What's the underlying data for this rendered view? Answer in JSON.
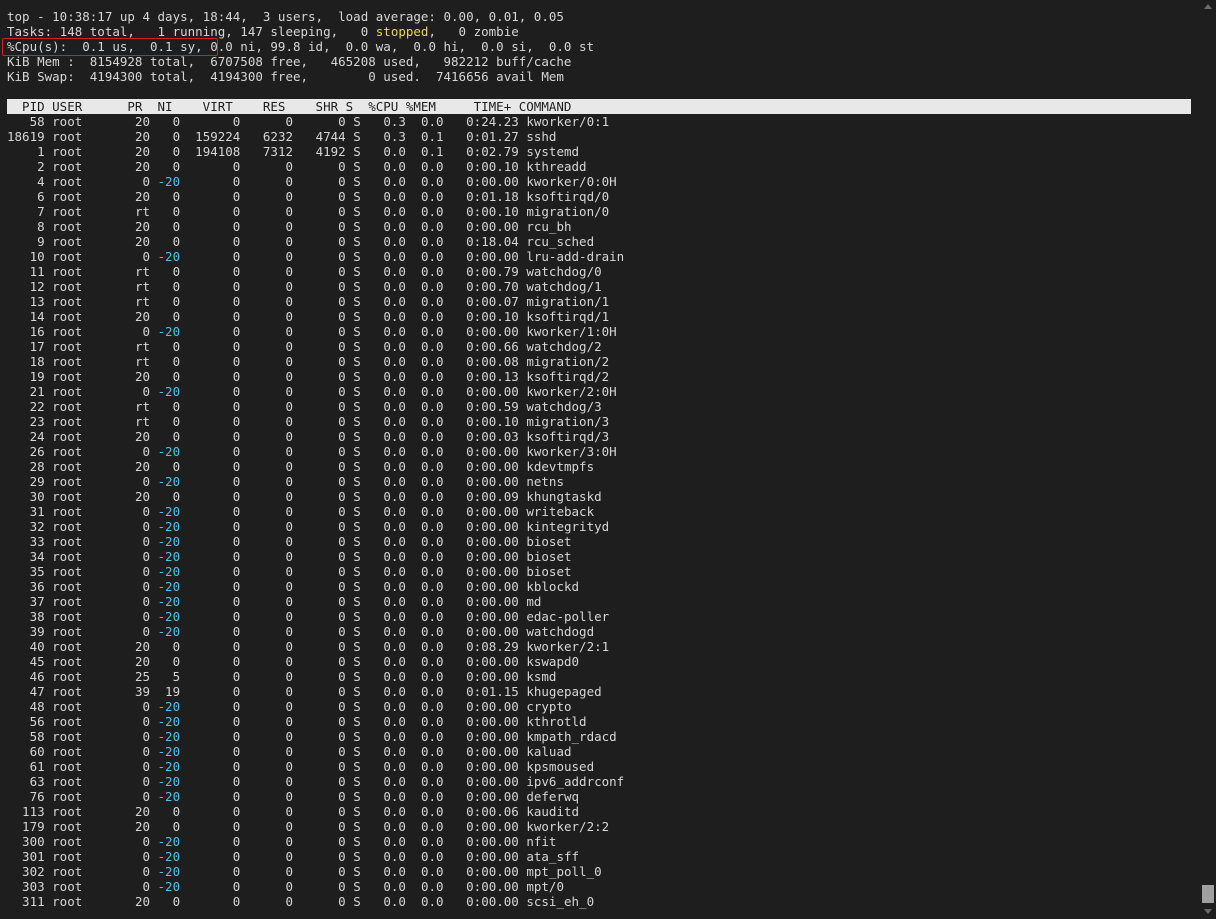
{
  "summary": {
    "top": "top - 10:38:17 up 4 days, 18:44,  3 users,  load average: 0.00, 0.01, 0.05",
    "tasks_before": "Tasks: 148 total,   1 running, 147 sleeping,   0 ",
    "tasks_stopped": "stopped",
    "tasks_after": ",   0 zombie",
    "cpu_highlighted": "%Cpu(s):  0.1 us,  0.1 sy,",
    "cpu_rest": " 0.0 ni, 99.8 id,  0.0 wa,  0.0 hi,  0.0 si,  0.0 st",
    "mem": "KiB Mem :  8154928 total,  6707508 free,   465208 used,   982212 buff/cache",
    "swap": "KiB Swap:  4194300 total,  4194300 free,        0 used.  7416656 avail Mem"
  },
  "header": "  PID USER      PR  NI    VIRT    RES    SHR S  %CPU %MEM     TIME+ COMMAND",
  "colors": {
    "background": "#1e1e1e",
    "text": "#d6d6d6",
    "stopped": "#e6d84a",
    "negative_nice": "#4fc1e9",
    "header_bg": "#e8e8e8",
    "highlight": "#d0202a"
  },
  "processes": [
    {
      "pid": "58",
      "user": "root",
      "pr": "20",
      "ni": "0",
      "virt": "0",
      "res": "0",
      "shr": "0",
      "s": "S",
      "cpu": "0.3",
      "mem": "0.0",
      "time": "0:24.23",
      "cmd": "kworker/0:1"
    },
    {
      "pid": "18619",
      "user": "root",
      "pr": "20",
      "ni": "0",
      "virt": "159224",
      "res": "6232",
      "shr": "4744",
      "s": "S",
      "cpu": "0.3",
      "mem": "0.1",
      "time": "0:01.27",
      "cmd": "sshd"
    },
    {
      "pid": "1",
      "user": "root",
      "pr": "20",
      "ni": "0",
      "virt": "194108",
      "res": "7312",
      "shr": "4192",
      "s": "S",
      "cpu": "0.0",
      "mem": "0.1",
      "time": "0:02.79",
      "cmd": "systemd"
    },
    {
      "pid": "2",
      "user": "root",
      "pr": "20",
      "ni": "0",
      "virt": "0",
      "res": "0",
      "shr": "0",
      "s": "S",
      "cpu": "0.0",
      "mem": "0.0",
      "time": "0:00.10",
      "cmd": "kthreadd"
    },
    {
      "pid": "4",
      "user": "root",
      "pr": "0",
      "ni": "-20",
      "virt": "0",
      "res": "0",
      "shr": "0",
      "s": "S",
      "cpu": "0.0",
      "mem": "0.0",
      "time": "0:00.00",
      "cmd": "kworker/0:0H"
    },
    {
      "pid": "6",
      "user": "root",
      "pr": "20",
      "ni": "0",
      "virt": "0",
      "res": "0",
      "shr": "0",
      "s": "S",
      "cpu": "0.0",
      "mem": "0.0",
      "time": "0:01.18",
      "cmd": "ksoftirqd/0"
    },
    {
      "pid": "7",
      "user": "root",
      "pr": "rt",
      "ni": "0",
      "virt": "0",
      "res": "0",
      "shr": "0",
      "s": "S",
      "cpu": "0.0",
      "mem": "0.0",
      "time": "0:00.10",
      "cmd": "migration/0"
    },
    {
      "pid": "8",
      "user": "root",
      "pr": "20",
      "ni": "0",
      "virt": "0",
      "res": "0",
      "shr": "0",
      "s": "S",
      "cpu": "0.0",
      "mem": "0.0",
      "time": "0:00.00",
      "cmd": "rcu_bh"
    },
    {
      "pid": "9",
      "user": "root",
      "pr": "20",
      "ni": "0",
      "virt": "0",
      "res": "0",
      "shr": "0",
      "s": "S",
      "cpu": "0.0",
      "mem": "0.0",
      "time": "0:18.04",
      "cmd": "rcu_sched"
    },
    {
      "pid": "10",
      "user": "root",
      "pr": "0",
      "ni": "-20",
      "virt": "0",
      "res": "0",
      "shr": "0",
      "s": "S",
      "cpu": "0.0",
      "mem": "0.0",
      "time": "0:00.00",
      "cmd": "lru-add-drain"
    },
    {
      "pid": "11",
      "user": "root",
      "pr": "rt",
      "ni": "0",
      "virt": "0",
      "res": "0",
      "shr": "0",
      "s": "S",
      "cpu": "0.0",
      "mem": "0.0",
      "time": "0:00.79",
      "cmd": "watchdog/0"
    },
    {
      "pid": "12",
      "user": "root",
      "pr": "rt",
      "ni": "0",
      "virt": "0",
      "res": "0",
      "shr": "0",
      "s": "S",
      "cpu": "0.0",
      "mem": "0.0",
      "time": "0:00.70",
      "cmd": "watchdog/1"
    },
    {
      "pid": "13",
      "user": "root",
      "pr": "rt",
      "ni": "0",
      "virt": "0",
      "res": "0",
      "shr": "0",
      "s": "S",
      "cpu": "0.0",
      "mem": "0.0",
      "time": "0:00.07",
      "cmd": "migration/1"
    },
    {
      "pid": "14",
      "user": "root",
      "pr": "20",
      "ni": "0",
      "virt": "0",
      "res": "0",
      "shr": "0",
      "s": "S",
      "cpu": "0.0",
      "mem": "0.0",
      "time": "0:00.10",
      "cmd": "ksoftirqd/1"
    },
    {
      "pid": "16",
      "user": "root",
      "pr": "0",
      "ni": "-20",
      "virt": "0",
      "res": "0",
      "shr": "0",
      "s": "S",
      "cpu": "0.0",
      "mem": "0.0",
      "time": "0:00.00",
      "cmd": "kworker/1:0H"
    },
    {
      "pid": "17",
      "user": "root",
      "pr": "rt",
      "ni": "0",
      "virt": "0",
      "res": "0",
      "shr": "0",
      "s": "S",
      "cpu": "0.0",
      "mem": "0.0",
      "time": "0:00.66",
      "cmd": "watchdog/2"
    },
    {
      "pid": "18",
      "user": "root",
      "pr": "rt",
      "ni": "0",
      "virt": "0",
      "res": "0",
      "shr": "0",
      "s": "S",
      "cpu": "0.0",
      "mem": "0.0",
      "time": "0:00.08",
      "cmd": "migration/2"
    },
    {
      "pid": "19",
      "user": "root",
      "pr": "20",
      "ni": "0",
      "virt": "0",
      "res": "0",
      "shr": "0",
      "s": "S",
      "cpu": "0.0",
      "mem": "0.0",
      "time": "0:00.13",
      "cmd": "ksoftirqd/2"
    },
    {
      "pid": "21",
      "user": "root",
      "pr": "0",
      "ni": "-20",
      "virt": "0",
      "res": "0",
      "shr": "0",
      "s": "S",
      "cpu": "0.0",
      "mem": "0.0",
      "time": "0:00.00",
      "cmd": "kworker/2:0H"
    },
    {
      "pid": "22",
      "user": "root",
      "pr": "rt",
      "ni": "0",
      "virt": "0",
      "res": "0",
      "shr": "0",
      "s": "S",
      "cpu": "0.0",
      "mem": "0.0",
      "time": "0:00.59",
      "cmd": "watchdog/3"
    },
    {
      "pid": "23",
      "user": "root",
      "pr": "rt",
      "ni": "0",
      "virt": "0",
      "res": "0",
      "shr": "0",
      "s": "S",
      "cpu": "0.0",
      "mem": "0.0",
      "time": "0:00.10",
      "cmd": "migration/3"
    },
    {
      "pid": "24",
      "user": "root",
      "pr": "20",
      "ni": "0",
      "virt": "0",
      "res": "0",
      "shr": "0",
      "s": "S",
      "cpu": "0.0",
      "mem": "0.0",
      "time": "0:00.03",
      "cmd": "ksoftirqd/3"
    },
    {
      "pid": "26",
      "user": "root",
      "pr": "0",
      "ni": "-20",
      "virt": "0",
      "res": "0",
      "shr": "0",
      "s": "S",
      "cpu": "0.0",
      "mem": "0.0",
      "time": "0:00.00",
      "cmd": "kworker/3:0H"
    },
    {
      "pid": "28",
      "user": "root",
      "pr": "20",
      "ni": "0",
      "virt": "0",
      "res": "0",
      "shr": "0",
      "s": "S",
      "cpu": "0.0",
      "mem": "0.0",
      "time": "0:00.00",
      "cmd": "kdevtmpfs"
    },
    {
      "pid": "29",
      "user": "root",
      "pr": "0",
      "ni": "-20",
      "virt": "0",
      "res": "0",
      "shr": "0",
      "s": "S",
      "cpu": "0.0",
      "mem": "0.0",
      "time": "0:00.00",
      "cmd": "netns"
    },
    {
      "pid": "30",
      "user": "root",
      "pr": "20",
      "ni": "0",
      "virt": "0",
      "res": "0",
      "shr": "0",
      "s": "S",
      "cpu": "0.0",
      "mem": "0.0",
      "time": "0:00.09",
      "cmd": "khungtaskd"
    },
    {
      "pid": "31",
      "user": "root",
      "pr": "0",
      "ni": "-20",
      "virt": "0",
      "res": "0",
      "shr": "0",
      "s": "S",
      "cpu": "0.0",
      "mem": "0.0",
      "time": "0:00.00",
      "cmd": "writeback"
    },
    {
      "pid": "32",
      "user": "root",
      "pr": "0",
      "ni": "-20",
      "virt": "0",
      "res": "0",
      "shr": "0",
      "s": "S",
      "cpu": "0.0",
      "mem": "0.0",
      "time": "0:00.00",
      "cmd": "kintegrityd"
    },
    {
      "pid": "33",
      "user": "root",
      "pr": "0",
      "ni": "-20",
      "virt": "0",
      "res": "0",
      "shr": "0",
      "s": "S",
      "cpu": "0.0",
      "mem": "0.0",
      "time": "0:00.00",
      "cmd": "bioset"
    },
    {
      "pid": "34",
      "user": "root",
      "pr": "0",
      "ni": "-20",
      "virt": "0",
      "res": "0",
      "shr": "0",
      "s": "S",
      "cpu": "0.0",
      "mem": "0.0",
      "time": "0:00.00",
      "cmd": "bioset"
    },
    {
      "pid": "35",
      "user": "root",
      "pr": "0",
      "ni": "-20",
      "virt": "0",
      "res": "0",
      "shr": "0",
      "s": "S",
      "cpu": "0.0",
      "mem": "0.0",
      "time": "0:00.00",
      "cmd": "bioset"
    },
    {
      "pid": "36",
      "user": "root",
      "pr": "0",
      "ni": "-20",
      "virt": "0",
      "res": "0",
      "shr": "0",
      "s": "S",
      "cpu": "0.0",
      "mem": "0.0",
      "time": "0:00.00",
      "cmd": "kblockd"
    },
    {
      "pid": "37",
      "user": "root",
      "pr": "0",
      "ni": "-20",
      "virt": "0",
      "res": "0",
      "shr": "0",
      "s": "S",
      "cpu": "0.0",
      "mem": "0.0",
      "time": "0:00.00",
      "cmd": "md"
    },
    {
      "pid": "38",
      "user": "root",
      "pr": "0",
      "ni": "-20",
      "virt": "0",
      "res": "0",
      "shr": "0",
      "s": "S",
      "cpu": "0.0",
      "mem": "0.0",
      "time": "0:00.00",
      "cmd": "edac-poller"
    },
    {
      "pid": "39",
      "user": "root",
      "pr": "0",
      "ni": "-20",
      "virt": "0",
      "res": "0",
      "shr": "0",
      "s": "S",
      "cpu": "0.0",
      "mem": "0.0",
      "time": "0:00.00",
      "cmd": "watchdogd"
    },
    {
      "pid": "40",
      "user": "root",
      "pr": "20",
      "ni": "0",
      "virt": "0",
      "res": "0",
      "shr": "0",
      "s": "S",
      "cpu": "0.0",
      "mem": "0.0",
      "time": "0:08.29",
      "cmd": "kworker/2:1"
    },
    {
      "pid": "45",
      "user": "root",
      "pr": "20",
      "ni": "0",
      "virt": "0",
      "res": "0",
      "shr": "0",
      "s": "S",
      "cpu": "0.0",
      "mem": "0.0",
      "time": "0:00.00",
      "cmd": "kswapd0"
    },
    {
      "pid": "46",
      "user": "root",
      "pr": "25",
      "ni": "5",
      "virt": "0",
      "res": "0",
      "shr": "0",
      "s": "S",
      "cpu": "0.0",
      "mem": "0.0",
      "time": "0:00.00",
      "cmd": "ksmd"
    },
    {
      "pid": "47",
      "user": "root",
      "pr": "39",
      "ni": "19",
      "virt": "0",
      "res": "0",
      "shr": "0",
      "s": "S",
      "cpu": "0.0",
      "mem": "0.0",
      "time": "0:01.15",
      "cmd": "khugepaged"
    },
    {
      "pid": "48",
      "user": "root",
      "pr": "0",
      "ni": "-20",
      "virt": "0",
      "res": "0",
      "shr": "0",
      "s": "S",
      "cpu": "0.0",
      "mem": "0.0",
      "time": "0:00.00",
      "cmd": "crypto"
    },
    {
      "pid": "56",
      "user": "root",
      "pr": "0",
      "ni": "-20",
      "virt": "0",
      "res": "0",
      "shr": "0",
      "s": "S",
      "cpu": "0.0",
      "mem": "0.0",
      "time": "0:00.00",
      "cmd": "kthrotld"
    },
    {
      "pid": "58",
      "user": "root",
      "pr": "0",
      "ni": "-20",
      "virt": "0",
      "res": "0",
      "shr": "0",
      "s": "S",
      "cpu": "0.0",
      "mem": "0.0",
      "time": "0:00.00",
      "cmd": "kmpath_rdacd"
    },
    {
      "pid": "60",
      "user": "root",
      "pr": "0",
      "ni": "-20",
      "virt": "0",
      "res": "0",
      "shr": "0",
      "s": "S",
      "cpu": "0.0",
      "mem": "0.0",
      "time": "0:00.00",
      "cmd": "kaluad"
    },
    {
      "pid": "61",
      "user": "root",
      "pr": "0",
      "ni": "-20",
      "virt": "0",
      "res": "0",
      "shr": "0",
      "s": "S",
      "cpu": "0.0",
      "mem": "0.0",
      "time": "0:00.00",
      "cmd": "kpsmoused"
    },
    {
      "pid": "63",
      "user": "root",
      "pr": "0",
      "ni": "-20",
      "virt": "0",
      "res": "0",
      "shr": "0",
      "s": "S",
      "cpu": "0.0",
      "mem": "0.0",
      "time": "0:00.00",
      "cmd": "ipv6_addrconf"
    },
    {
      "pid": "76",
      "user": "root",
      "pr": "0",
      "ni": "-20",
      "virt": "0",
      "res": "0",
      "shr": "0",
      "s": "S",
      "cpu": "0.0",
      "mem": "0.0",
      "time": "0:00.00",
      "cmd": "deferwq"
    },
    {
      "pid": "113",
      "user": "root",
      "pr": "20",
      "ni": "0",
      "virt": "0",
      "res": "0",
      "shr": "0",
      "s": "S",
      "cpu": "0.0",
      "mem": "0.0",
      "time": "0:00.06",
      "cmd": "kauditd"
    },
    {
      "pid": "179",
      "user": "root",
      "pr": "20",
      "ni": "0",
      "virt": "0",
      "res": "0",
      "shr": "0",
      "s": "S",
      "cpu": "0.0",
      "mem": "0.0",
      "time": "0:00.00",
      "cmd": "kworker/2:2"
    },
    {
      "pid": "300",
      "user": "root",
      "pr": "0",
      "ni": "-20",
      "virt": "0",
      "res": "0",
      "shr": "0",
      "s": "S",
      "cpu": "0.0",
      "mem": "0.0",
      "time": "0:00.00",
      "cmd": "nfit"
    },
    {
      "pid": "301",
      "user": "root",
      "pr": "0",
      "ni": "-20",
      "virt": "0",
      "res": "0",
      "shr": "0",
      "s": "S",
      "cpu": "0.0",
      "mem": "0.0",
      "time": "0:00.00",
      "cmd": "ata_sff"
    },
    {
      "pid": "302",
      "user": "root",
      "pr": "0",
      "ni": "-20",
      "virt": "0",
      "res": "0",
      "shr": "0",
      "s": "S",
      "cpu": "0.0",
      "mem": "0.0",
      "time": "0:00.00",
      "cmd": "mpt_poll_0"
    },
    {
      "pid": "303",
      "user": "root",
      "pr": "0",
      "ni": "-20",
      "virt": "0",
      "res": "0",
      "shr": "0",
      "s": "S",
      "cpu": "0.0",
      "mem": "0.0",
      "time": "0:00.00",
      "cmd": "mpt/0"
    },
    {
      "pid": "311",
      "user": "root",
      "pr": "20",
      "ni": "0",
      "virt": "0",
      "res": "0",
      "shr": "0",
      "s": "S",
      "cpu": "0.0",
      "mem": "0.0",
      "time": "0:00.00",
      "cmd": "scsi_eh_0"
    }
  ]
}
